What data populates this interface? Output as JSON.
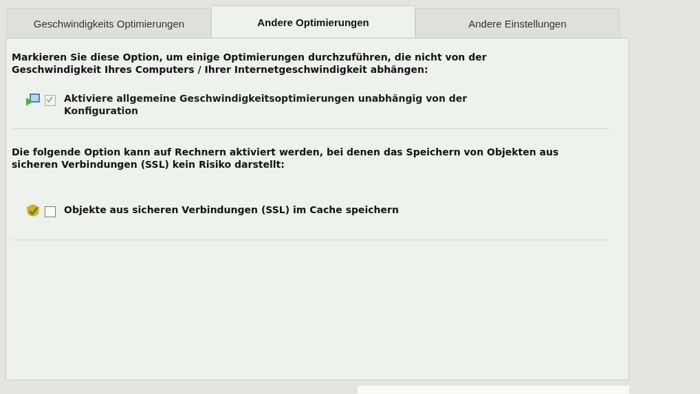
{
  "tabs": [
    {
      "label": "Geschwindigkeits Optimierungen",
      "selected": false
    },
    {
      "label": "Andere Optimierungen",
      "selected": true
    },
    {
      "label": "Andere Einstellungen",
      "selected": false
    }
  ],
  "sections": [
    {
      "description": "Markieren Sie diese Option, um einige Optimierungen durchzuführen, die nicht von der Geschwindigkeit Ihres Computers / Ihrer Internetgeschwindigkeit abhängen:",
      "option": {
        "label": "Aktiviere allgemeine Geschwindigkeitsoptimierungen unabhängig von der Konfiguration",
        "checked": true,
        "disabled": true,
        "kind": "monitor"
      }
    },
    {
      "description": "Die folgende Option kann auf Rechnern aktiviert werden, bei denen das Speichern von Objekten aus sicheren Verbindungen (SSL) kein Risiko darstellt:",
      "option": {
        "label": "Objekte aus sicheren Verbindungen (SSL) im Cache speichern",
        "checked": false,
        "disabled": false,
        "kind": "shield"
      }
    }
  ]
}
